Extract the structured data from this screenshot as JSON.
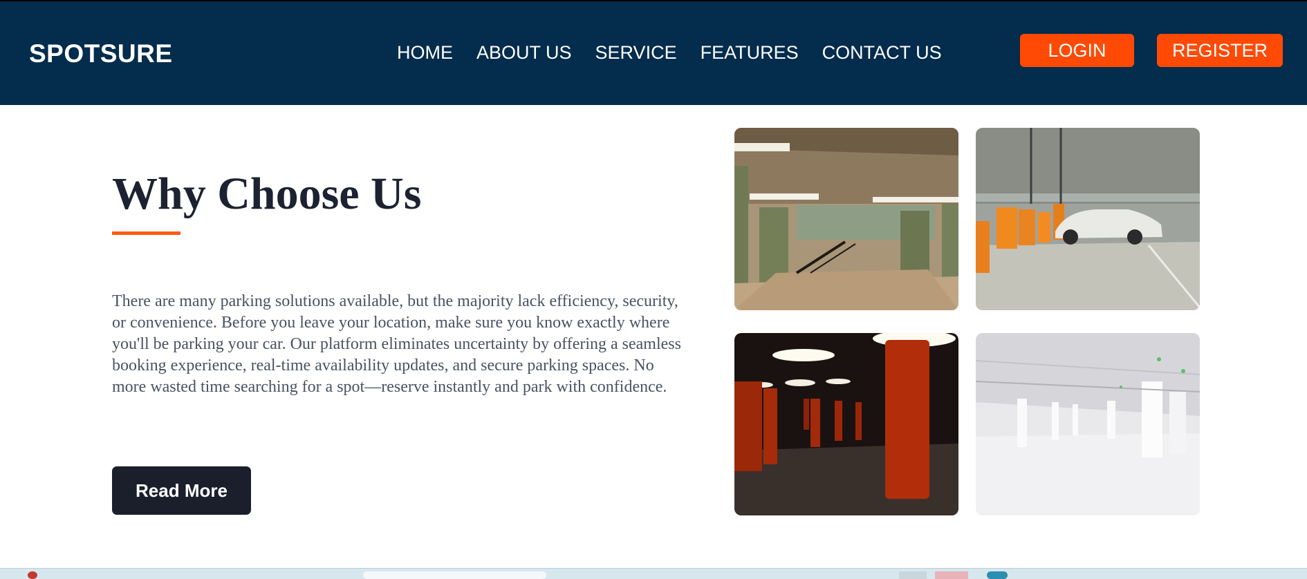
{
  "header": {
    "brand": "SPOTSURE",
    "nav": [
      {
        "label": "HOME"
      },
      {
        "label": "ABOUT US"
      },
      {
        "label": "SERVICE"
      },
      {
        "label": "FEATURES"
      },
      {
        "label": "CONTACT US"
      }
    ],
    "login_label": "LOGIN",
    "register_label": "REGISTER"
  },
  "main": {
    "heading": "Why Choose Us",
    "body": "There are many parking solutions available, but the majority lack efficiency, security, or convenience. Before you leave your location, make sure you know exactly where you'll be parking your car. Our platform eliminates uncertainty by offering a seamless booking experience, real-time availability updates, and secure parking spaces. No more wasted time searching for a spot—reserve instantly and park with confidence.",
    "read_more_label": "Read More"
  },
  "gallery": {
    "images": [
      {
        "subject": "underground-hall-photo"
      },
      {
        "subject": "parked-white-car-photo"
      },
      {
        "subject": "red-pillars-garage-photo"
      },
      {
        "subject": "white-parking-garage-photo"
      }
    ]
  },
  "colors": {
    "navbar_bg": "#042c4c",
    "accent_orange": "#ff4a06",
    "dark_button": "#1b1f2c",
    "heading_text": "#1c2231"
  }
}
